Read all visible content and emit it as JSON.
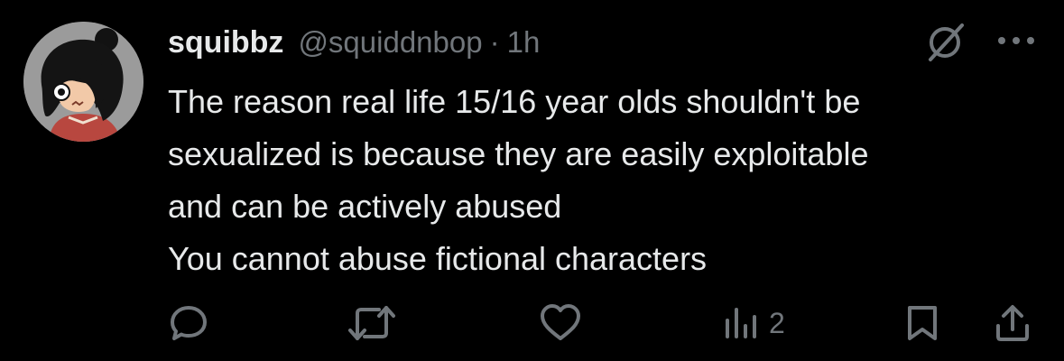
{
  "tweet": {
    "author": {
      "display_name": "squibbz",
      "handle": "@squiddnbop",
      "avatar_icon": "cartoon-character-avatar"
    },
    "separator": "·",
    "time": "1h",
    "text_lines": [
      "The reason real life 15/16 year olds shouldn't be",
      "sexualized is because they are easily exploitable",
      "and can be actively abused",
      "You cannot abuse fictional characters"
    ]
  },
  "header_icons": [
    "grok-icon",
    "more-icon"
  ],
  "actions": {
    "icons": [
      "reply-icon",
      "retweet-icon",
      "like-icon",
      "views-icon",
      "bookmark-icon",
      "share-icon"
    ],
    "views_count": "2"
  },
  "colors": {
    "background": "#000000",
    "primary_text": "#e7e9ea",
    "secondary_text": "#71767b"
  }
}
